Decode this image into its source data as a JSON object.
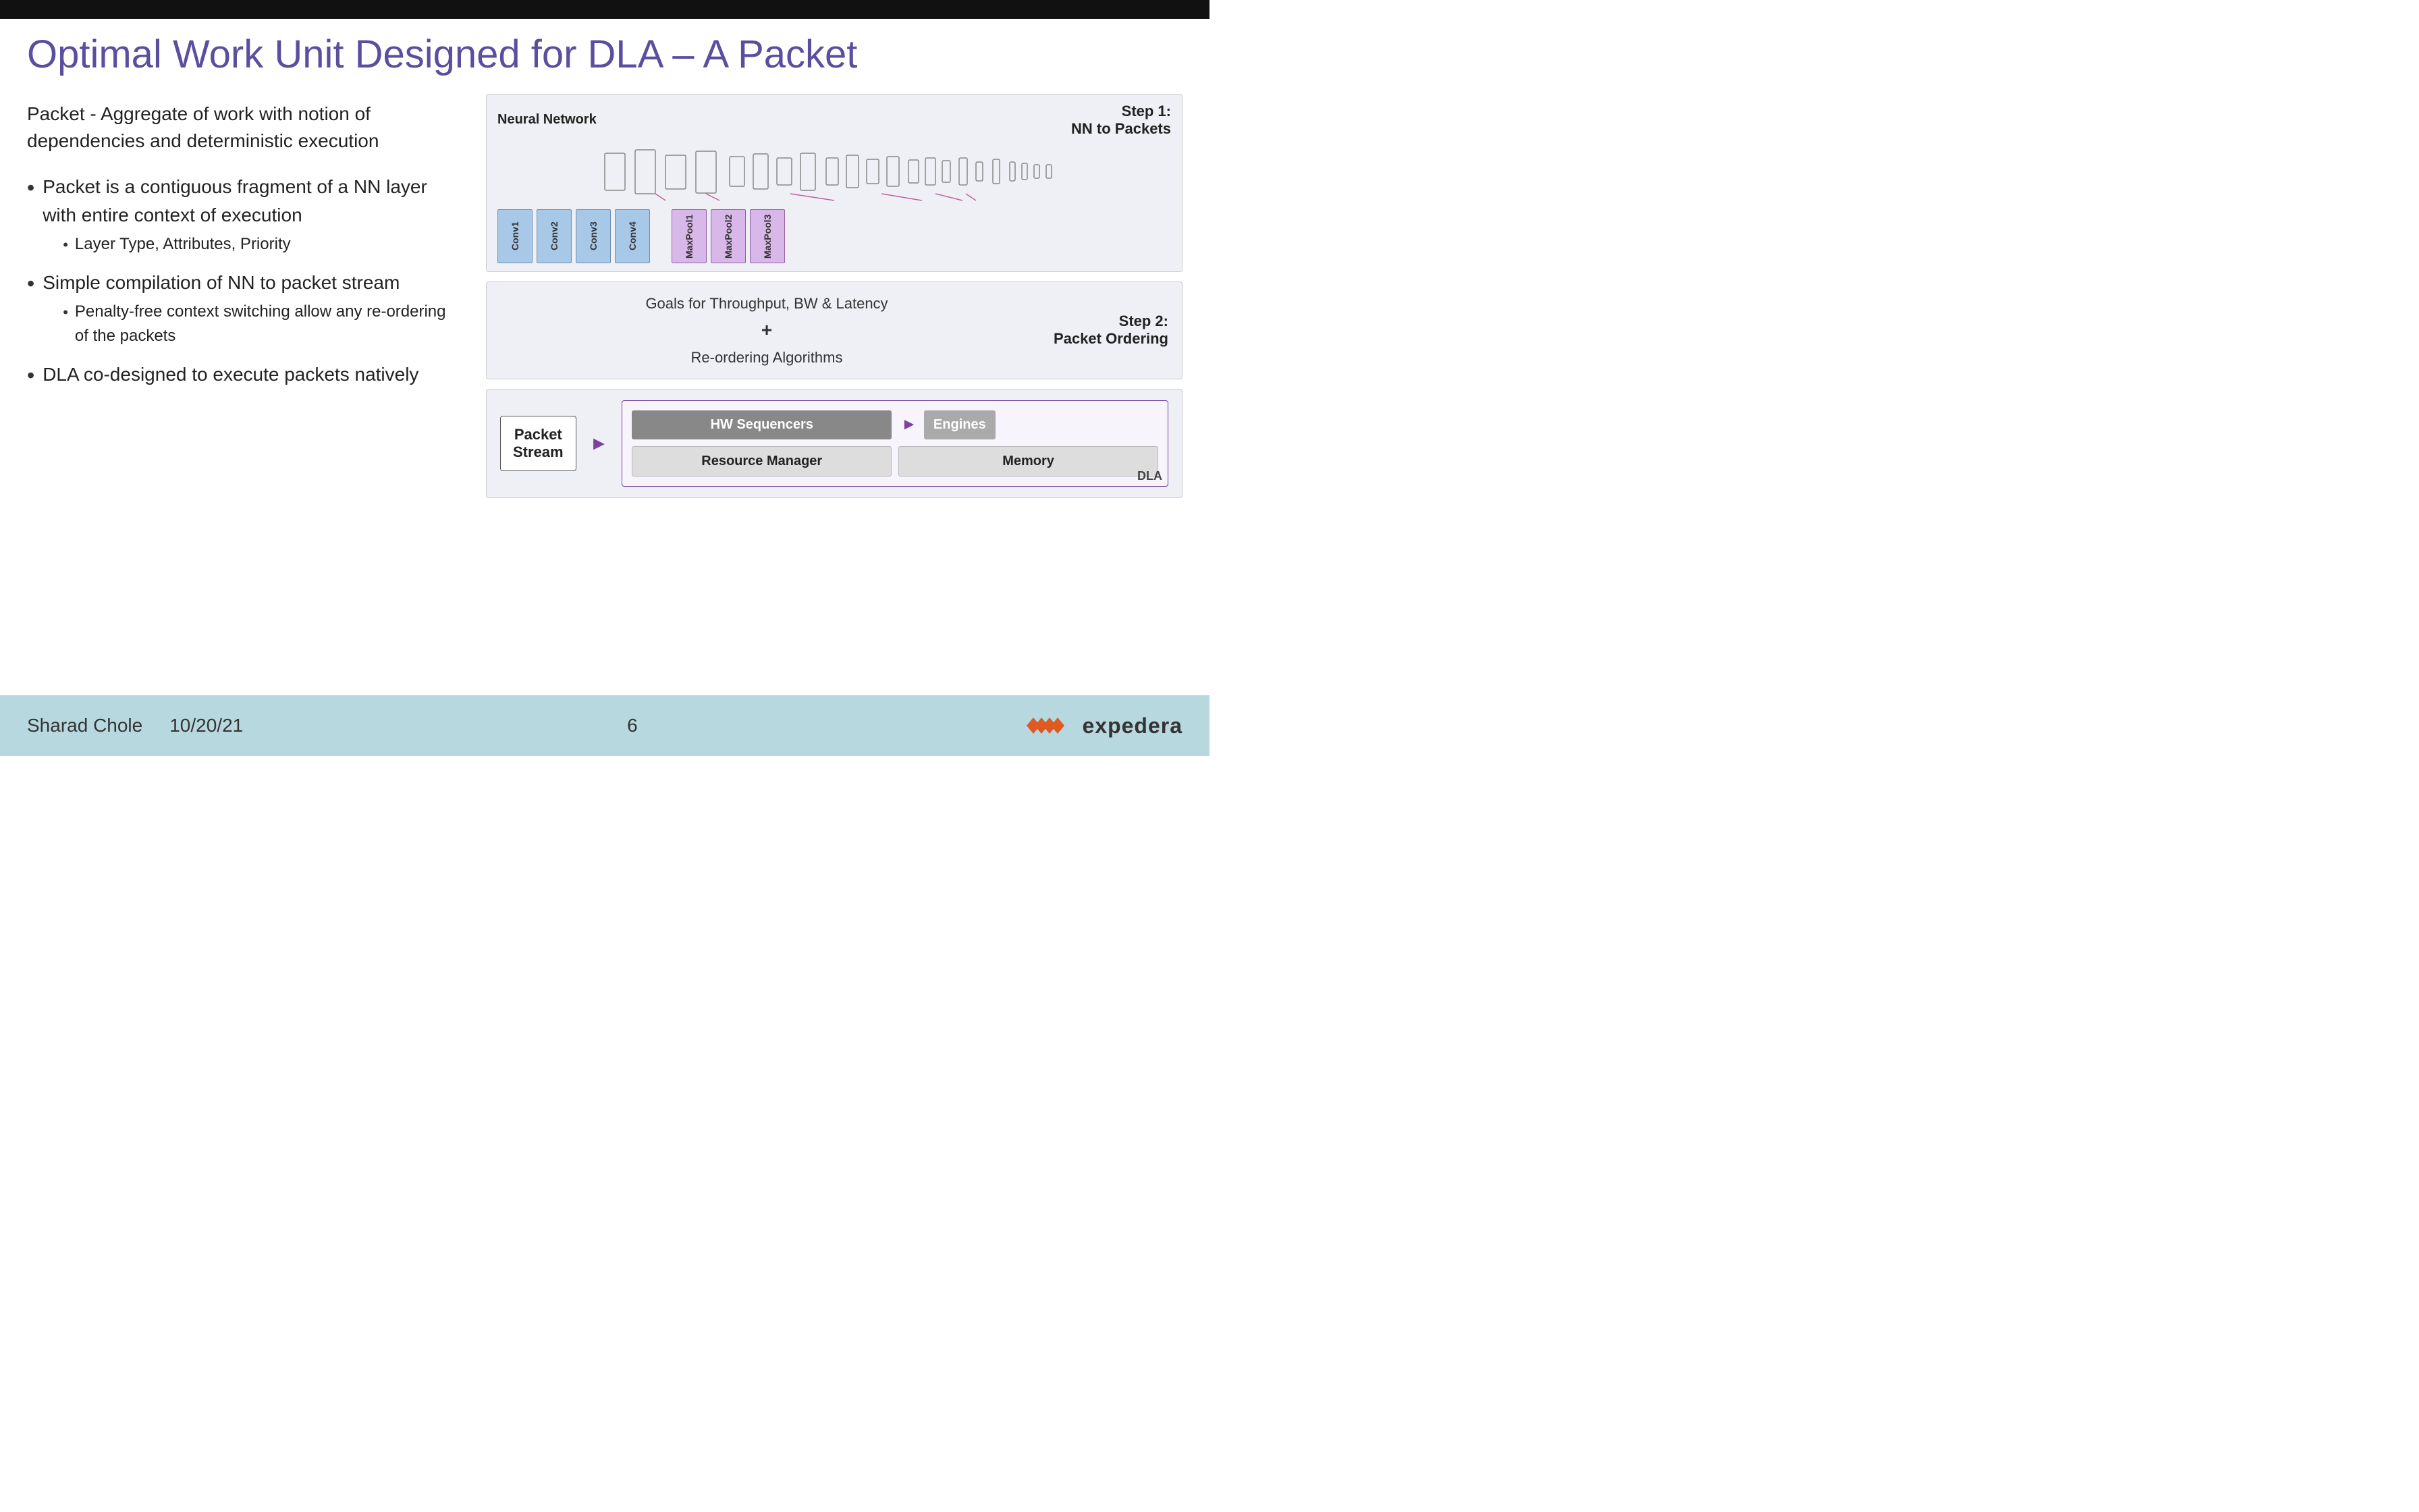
{
  "topBar": {},
  "title": "Optimal Work Unit Designed for DLA – A Packet",
  "left": {
    "intro": "Packet - Aggregate of work with notion of dependencies and deterministic execution",
    "bullets": [
      {
        "main": "Packet is a contiguous fragment of a NN layer with entire context of execution",
        "subs": [
          "Layer Type, Attributes, Priority"
        ]
      },
      {
        "main": "Simple compilation of NN to packet stream",
        "subs": [
          "Penalty-free context switching allow any re-ordering of the packets"
        ]
      },
      {
        "main": "DLA co-designed to execute packets natively",
        "subs": []
      }
    ]
  },
  "right": {
    "step1": {
      "networkLabel": "Neural Network",
      "stepLabel": "Step 1:\nNN to Packets",
      "convBoxes": [
        "Conv1",
        "Conv2",
        "Conv3",
        "Conv4"
      ],
      "poolBoxes": [
        "MaxPool1",
        "MaxPool2",
        "MaxPool3"
      ]
    },
    "step2": {
      "content": "Goals for Throughput, BW & Latency\n+\nRe-ordering Algorithms",
      "stepLabel": "Step 2:\nPacket Ordering"
    },
    "step3": {
      "packetStream": "Packet\nStream",
      "hwSequencers": "HW Sequencers",
      "engines": "Engines",
      "resourceManager": "Resource Manager",
      "memory": "Memory",
      "dlaLabel": "DLA"
    }
  },
  "footer": {
    "author": "Sharad Chole",
    "date": "10/20/21",
    "pageNumber": "6",
    "logoText": "expedera"
  }
}
